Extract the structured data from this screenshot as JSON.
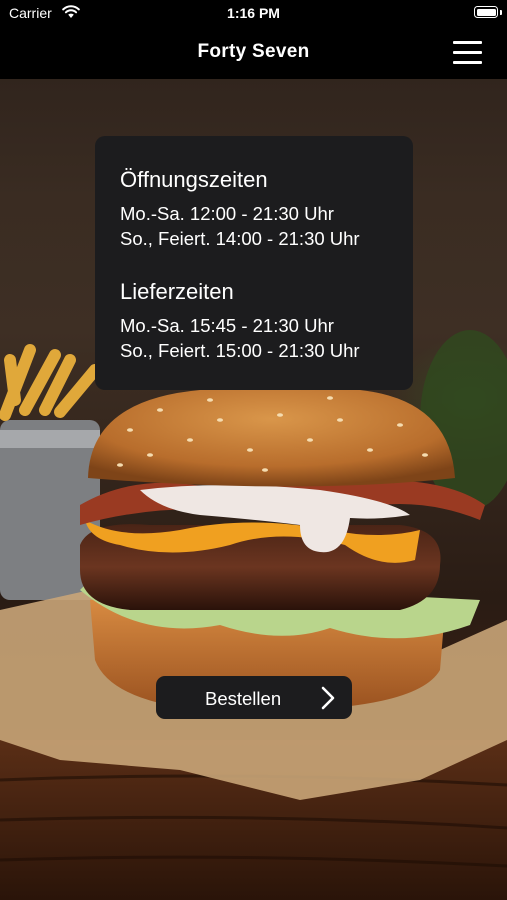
{
  "status_bar": {
    "carrier": "Carrier",
    "time": "1:16 PM"
  },
  "nav": {
    "title": "Forty Seven"
  },
  "opening_hours": {
    "title": "Öffnungszeiten",
    "lines": [
      "Mo.-Sa. 12:00 - 21:30 Uhr",
      "So., Feiert. 14:00 - 21:30 Uhr"
    ]
  },
  "delivery_hours": {
    "title": "Lieferzeiten",
    "lines": [
      "Mo.-Sa. 15:45 - 21:30 Uhr",
      "So., Feiert. 15:00 - 21:30 Uhr"
    ]
  },
  "order_button": {
    "label": "Bestellen"
  },
  "icons": {
    "wifi": "wifi-icon",
    "battery": "battery-icon",
    "menu": "hamburger-menu-icon",
    "chevron": "chevron-right-icon"
  },
  "colors": {
    "bars": "#000000",
    "card": "#1c1c1e",
    "text": "#ffffff"
  }
}
